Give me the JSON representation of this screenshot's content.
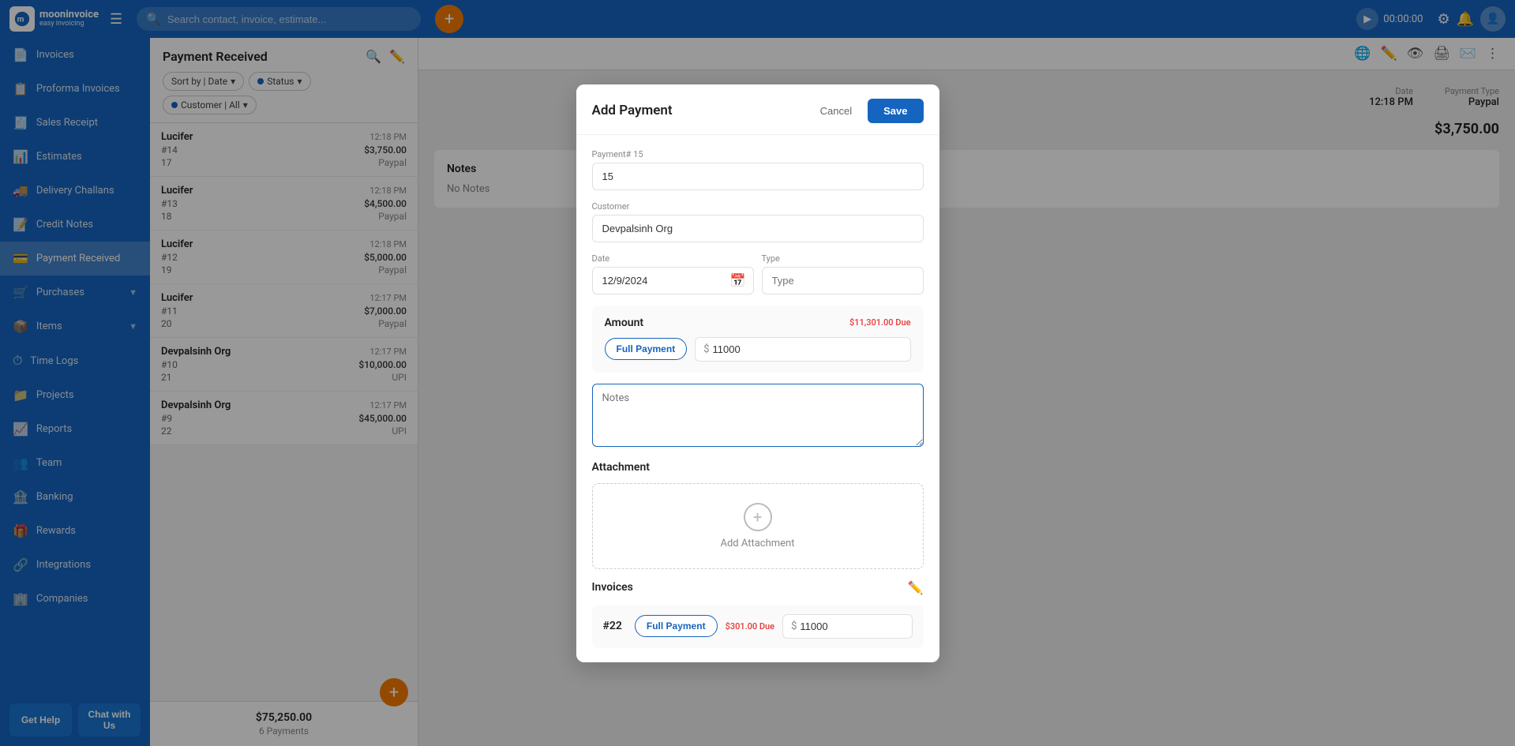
{
  "app": {
    "name": "mooninvoice",
    "tagline": "easy invoicing"
  },
  "topnav": {
    "search_placeholder": "Search contact, invoice, estimate...",
    "timer": "00:00:00",
    "add_btn_label": "+"
  },
  "sidebar": {
    "items": [
      {
        "id": "invoices",
        "label": "Invoices",
        "icon": "📄",
        "active": false
      },
      {
        "id": "proforma-invoices",
        "label": "Proforma Invoices",
        "icon": "📋",
        "active": false
      },
      {
        "id": "sales-receipt",
        "label": "Sales Receipt",
        "icon": "🧾",
        "active": false
      },
      {
        "id": "estimates",
        "label": "Estimates",
        "icon": "📊",
        "active": false
      },
      {
        "id": "delivery-challans",
        "label": "Delivery Challans",
        "icon": "🚚",
        "active": false
      },
      {
        "id": "credit-notes",
        "label": "Credit Notes",
        "icon": "📝",
        "active": false
      },
      {
        "id": "payment-received",
        "label": "Payment Received",
        "icon": "💳",
        "active": true
      },
      {
        "id": "purchases",
        "label": "Purchases",
        "icon": "🛒",
        "active": false,
        "has_sub": true
      },
      {
        "id": "items",
        "label": "Items",
        "icon": "📦",
        "active": false,
        "has_sub": true
      },
      {
        "id": "time-logs",
        "label": "Time Logs",
        "icon": "⏱",
        "active": false
      },
      {
        "id": "projects",
        "label": "Projects",
        "icon": "📁",
        "active": false
      },
      {
        "id": "reports",
        "label": "Reports",
        "icon": "📈",
        "active": false
      },
      {
        "id": "team",
        "label": "Team",
        "icon": "👥",
        "active": false
      },
      {
        "id": "banking",
        "label": "Banking",
        "icon": "🏦",
        "active": false
      },
      {
        "id": "rewards",
        "label": "Rewards",
        "icon": "🎁",
        "active": false
      },
      {
        "id": "integrations",
        "label": "Integrations",
        "icon": "🔗",
        "active": false
      },
      {
        "id": "companies",
        "label": "Companies",
        "icon": "🏢",
        "active": false
      }
    ],
    "buttons": {
      "help": "Get Help",
      "chat": "Chat with Us"
    }
  },
  "list_panel": {
    "title": "Payment Received",
    "filters": [
      {
        "label": "Sort by | Date",
        "has_dot": false
      },
      {
        "label": "Status",
        "has_dot": true
      },
      {
        "label": "Customer | All",
        "has_dot": true
      }
    ],
    "items": [
      {
        "name": "Lucifer",
        "time": "12:18 PM",
        "id": "#14",
        "amount": "$3,750.00",
        "method": "Paypal",
        "row2_id": "17"
      },
      {
        "name": "Lucifer",
        "time": "12:18 PM",
        "id": "#13",
        "amount": "$4,500.00",
        "method": "Paypal",
        "row2_id": "18"
      },
      {
        "name": "Lucifer",
        "time": "12:18 PM",
        "id": "#12",
        "amount": "$5,000.00",
        "method": "Paypal",
        "row2_id": "19"
      },
      {
        "name": "Lucifer",
        "time": "12:17 PM",
        "id": "#11",
        "amount": "$7,000.00",
        "method": "Paypal",
        "row2_id": "20"
      },
      {
        "name": "Devpalsinh Org",
        "time": "12:17 PM",
        "id": "#10",
        "amount": "$10,000.00",
        "method": "UPI",
        "row2_id": "21"
      },
      {
        "name": "Devpalsinh Org",
        "time": "12:17 PM",
        "id": "#9",
        "amount": "$45,000.00",
        "method": "UPI",
        "row2_id": "22"
      }
    ],
    "footer_total": "$75,250.00",
    "footer_sub": "6 Payments"
  },
  "detail_panel": {
    "toolbar_icons": [
      "globe",
      "edit",
      "eye",
      "print",
      "email",
      "more"
    ],
    "info": {
      "date_label": "Date",
      "date_value": "12:18 PM",
      "payment_type_label": "Payment Type",
      "payment_type_value": "Paypal"
    },
    "amount": "$3,750.00",
    "notes_title": "Notes",
    "notes_empty": "No Notes"
  },
  "modal": {
    "title": "Add Payment",
    "cancel_label": "Cancel",
    "save_label": "Save",
    "fields": {
      "payment_number_label": "Payment# 15",
      "payment_number_value": "15",
      "customer_label": "Customer",
      "customer_value": "Devpalsinh Org",
      "date_label": "Date",
      "date_value": "12/9/2024",
      "type_label": "Type",
      "type_value": "",
      "amount_label": "Amount",
      "full_payment_label": "Full Payment",
      "due_amount": "$11,301.00 Due",
      "amount_symbol": "$",
      "amount_value": "11000",
      "notes_placeholder": "Notes",
      "attachment_label": "Attachment",
      "add_attachment_label": "Add Attachment",
      "invoices_label": "Invoices",
      "invoice_id": "#22",
      "invoice_due": "$301.00 Due",
      "invoice_amount_symbol": "$",
      "invoice_amount_value": "11000"
    }
  }
}
